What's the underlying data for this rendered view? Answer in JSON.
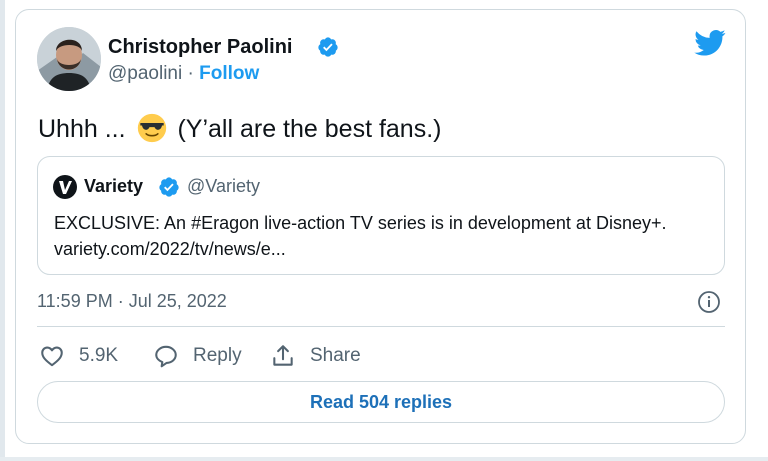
{
  "tweet": {
    "author_name": "Christopher Paolini",
    "author_handle": "@paolini",
    "separator": "·",
    "follow_label": "Follow",
    "text_before_emoji": "Uhhh ...",
    "emoji": "smiling-face-with-sunglasses",
    "text_after_emoji": "(Y’all are the best fans.)",
    "timestamp": "11:59 PM · Jul 25, 2022"
  },
  "quoted": {
    "name": "Variety",
    "handle": "@Variety",
    "body": "EXCLUSIVE: An #Eragon live-action TV series is in development at Disney+. variety.com/2022/tv/news/e..."
  },
  "actions": {
    "like_count": "5.9K",
    "reply_label": "Reply",
    "share_label": "Share"
  },
  "replies_button": "Read 504 replies",
  "icons": [
    "verified-badge-icon",
    "twitter-bird-icon",
    "heart-icon",
    "reply-bubble-icon",
    "share-icon",
    "info-icon"
  ],
  "colors": {
    "brand_blue": "#1d9bf0",
    "link_blue": "#1d70b8",
    "secondary_text": "#536471",
    "border": "#cfd9de"
  }
}
